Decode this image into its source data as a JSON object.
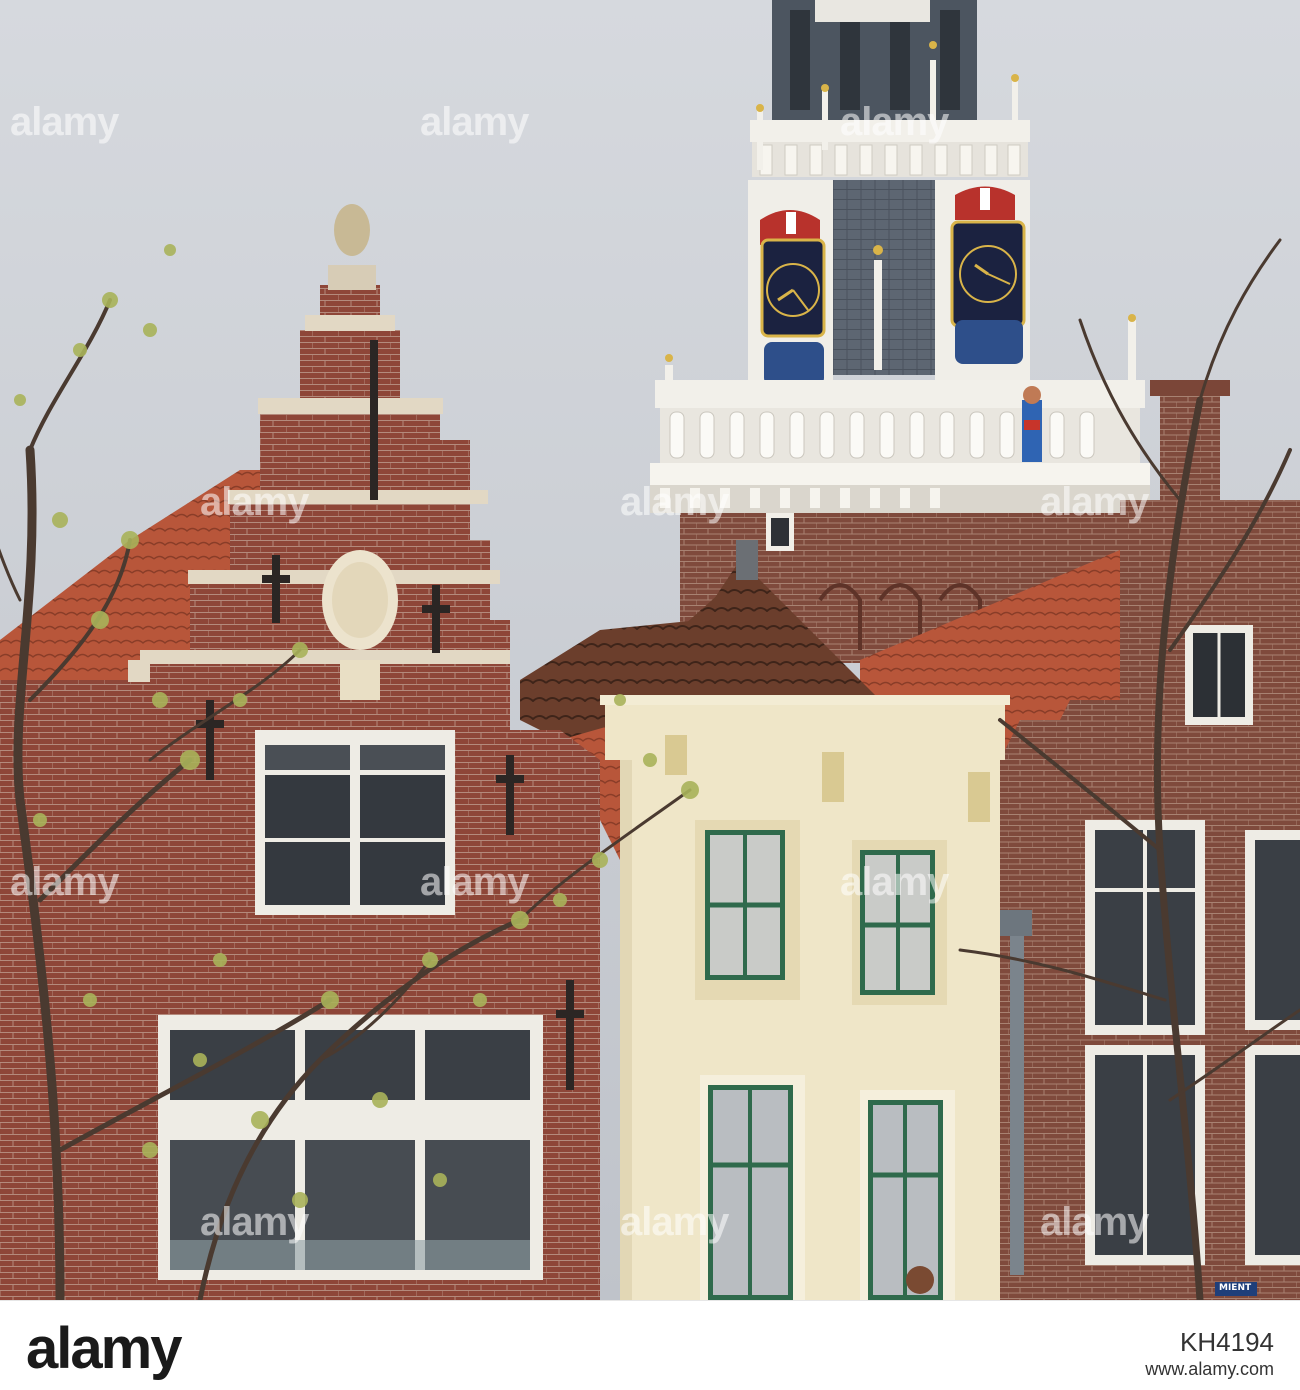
{
  "watermark": {
    "text": "alamy"
  },
  "sign": {
    "street": "MIENT"
  },
  "footer": {
    "logo": "alamy",
    "image_id": "KH4194",
    "url": "www.alamy.com"
  },
  "colors": {
    "sky": "#c9ccd2",
    "brick": "#8e4638",
    "roof_tile": "#b8563a",
    "cream_facade": "#efe6c8",
    "tower_slate": "#5d6672",
    "trim_white": "#f2f0ea",
    "clock_face": "#1b2240",
    "clock_gold": "#d9b449"
  }
}
